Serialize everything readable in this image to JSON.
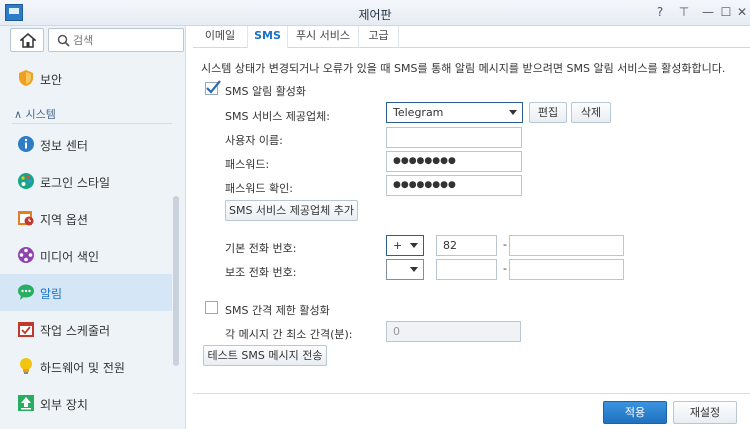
{
  "window": {
    "title": "제어판",
    "help_glyph": "?",
    "pin_glyph": "⊤",
    "minimize_glyph": "—",
    "maximize_glyph": "☐",
    "close_glyph": "✕"
  },
  "sidebar": {
    "search_placeholder": "검색",
    "items_top": [
      {
        "label": "보안",
        "icon": "shield-icon",
        "color": "#f0a020"
      }
    ],
    "section_label": "∧  시스템",
    "items": [
      {
        "label": "정보 센터",
        "icon": "info-icon",
        "color": "#2d7cc7"
      },
      {
        "label": "로그인 스타일",
        "icon": "palette-icon",
        "color": "#17a589"
      },
      {
        "label": "지역 옵션",
        "icon": "clock-calendar-icon",
        "color": "#e67e22"
      },
      {
        "label": "미디어 색인",
        "icon": "film-reel-icon",
        "color": "#8e44ad"
      },
      {
        "label": "알림",
        "icon": "chat-bubble-icon",
        "color": "#27ae60"
      },
      {
        "label": "작업 스케줄러",
        "icon": "calendar-check-icon",
        "color": "#c0392b"
      },
      {
        "label": "하드웨어 및 전원",
        "icon": "lightbulb-icon",
        "color": "#f1c40f"
      },
      {
        "label": "외부 장치",
        "icon": "upload-icon",
        "color": "#27ae60"
      }
    ]
  },
  "tabs": [
    "이메일",
    "SMS",
    "푸시 서비스",
    "고급"
  ],
  "main": {
    "description": "시스템 상태가 변경되거나 오류가 있을 때 SMS를 통해 알림 메시지를 받으려면 SMS 알림 서비스를 활성화합니다.",
    "enable_sms_label": "SMS 알림 활성화",
    "provider_label": "SMS 서비스 제공업체:",
    "provider_value": "Telegram",
    "edit_button": "편집",
    "delete_button": "삭제",
    "username_label": "사용자 이름:",
    "username_value": "",
    "password_label": "패스워드:",
    "password_value": "●●●●●●●●",
    "confirm_password_label": "패스워드 확인:",
    "confirm_password_value": "●●●●●●●●",
    "add_provider_button": "SMS 서비스 제공업체 추가",
    "primary_phone_label": "기본 전화 번호:",
    "primary_prefix": "+",
    "primary_country_code": "82",
    "primary_number": "",
    "secondary_phone_label": "보조 전화 번호:",
    "secondary_prefix": "",
    "secondary_country_code": "",
    "secondary_number": "",
    "dash": "-",
    "enable_interval_label": "SMS 간격 제한 활성화",
    "interval_label": "각 메시지 간 최소 간격(분):",
    "interval_value": "0",
    "test_button": "테스트 SMS 메시지 전송"
  },
  "footer": {
    "apply_button": "적용",
    "reset_button": "재설정"
  }
}
